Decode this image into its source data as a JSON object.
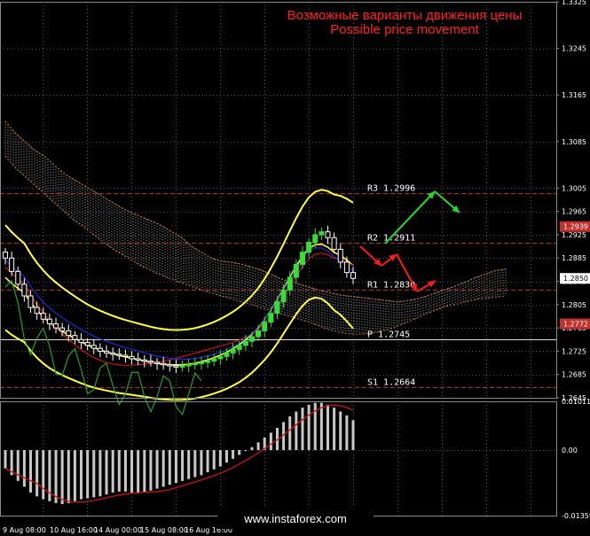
{
  "titles": {
    "ru": "Возможные варианты движения цены",
    "en": "Possible price movement"
  },
  "watermark": "www.instaforex.com",
  "colors": {
    "background": "#000000",
    "grid": "#4a4a4a",
    "title": "#ff2020",
    "bollinger": "#ffff33",
    "ma_red": "#cc1111",
    "ma_blue": "#1a2bdd",
    "chikou": "#1fa51f",
    "bull_candle": "#35e035",
    "bear_candle": "#ffffff",
    "forecast_green": "#22dd22",
    "forecast_red": "#ff1a1a",
    "macd_hist": "#c8c8c8",
    "macd_signal": "#cc1111",
    "levels": "#b03030",
    "price_box": "#ffffff",
    "highlight_box": "#c2302c"
  },
  "chart_data": {
    "type": "candlestick",
    "price_axis": {
      "ticks": [
        "1.3325",
        "1.3245",
        "1.3165",
        "1.3085",
        "1.3005",
        "1.2965",
        "1.2925",
        "1.2885",
        "1.2845",
        "1.2805",
        "1.2765",
        "1.2725",
        "1.2685",
        "1.2645"
      ],
      "ylim": [
        1.2645,
        1.3325
      ]
    },
    "time_axis": {
      "labels": [
        "9 Aug 08:00",
        "10 Aug 16:00",
        "14 Aug 00:00",
        "15 Aug 08:00",
        "16 Aug 16:00"
      ]
    },
    "current_price": "1.2850",
    "highlighted_prices": [
      "1.2939",
      "1.2772"
    ],
    "levels": [
      {
        "label": "R3",
        "value": "1.2996"
      },
      {
        "label": "R2",
        "value": "1.2911"
      },
      {
        "label": "R1",
        "value": "1.2830"
      },
      {
        "label": "P",
        "value": "1.2745"
      },
      {
        "label": "S1",
        "value": "1.2664"
      }
    ],
    "indicator": {
      "type": "histogram",
      "ticks": [
        "0.01011",
        "0.00",
        "-0.01359"
      ],
      "ylim": [
        -0.01359,
        0.01011
      ]
    },
    "series_estimates": {
      "close": [
        1.2885,
        1.2862,
        1.284,
        1.282,
        1.28,
        1.279,
        1.278,
        1.2772,
        1.2765,
        1.276,
        1.2752,
        1.2745,
        1.274,
        1.2735,
        1.273,
        1.2725,
        1.2722,
        1.272,
        1.2718,
        1.2716,
        1.2712,
        1.271,
        1.2708,
        1.2706,
        1.2704,
        1.2702,
        1.27,
        1.2698,
        1.27,
        1.2702,
        1.2704,
        1.2706,
        1.2708,
        1.2712,
        1.2716,
        1.2722,
        1.2728,
        1.2735,
        1.2742,
        1.275,
        1.276,
        1.2775,
        1.279,
        1.281,
        1.283,
        1.2852,
        1.2874,
        1.2895,
        1.2912,
        1.2925,
        1.293,
        1.292,
        1.29,
        1.2878,
        1.286,
        1.285
      ],
      "macd": [
        -0.0038,
        -0.0052,
        -0.0064,
        -0.0076,
        -0.0088,
        -0.0096,
        -0.0102,
        -0.0106,
        -0.011,
        -0.0112,
        -0.011,
        -0.0106,
        -0.0102,
        -0.01,
        -0.0098,
        -0.0096,
        -0.0092,
        -0.0088,
        -0.0086,
        -0.0086,
        -0.0088,
        -0.009,
        -0.0088,
        -0.0084,
        -0.008,
        -0.0076,
        -0.0072,
        -0.0068,
        -0.0064,
        -0.006,
        -0.0056,
        -0.0052,
        -0.0046,
        -0.004,
        -0.0034,
        -0.0026,
        -0.0018,
        -0.001,
        -0.0002,
        0.0006,
        0.0016,
        0.0026,
        0.0036,
        0.0046,
        0.0058,
        0.007,
        0.008,
        0.0088,
        0.0094,
        0.0098,
        0.0098,
        0.0094,
        0.0088,
        0.008,
        0.0072,
        0.0062
      ]
    }
  }
}
